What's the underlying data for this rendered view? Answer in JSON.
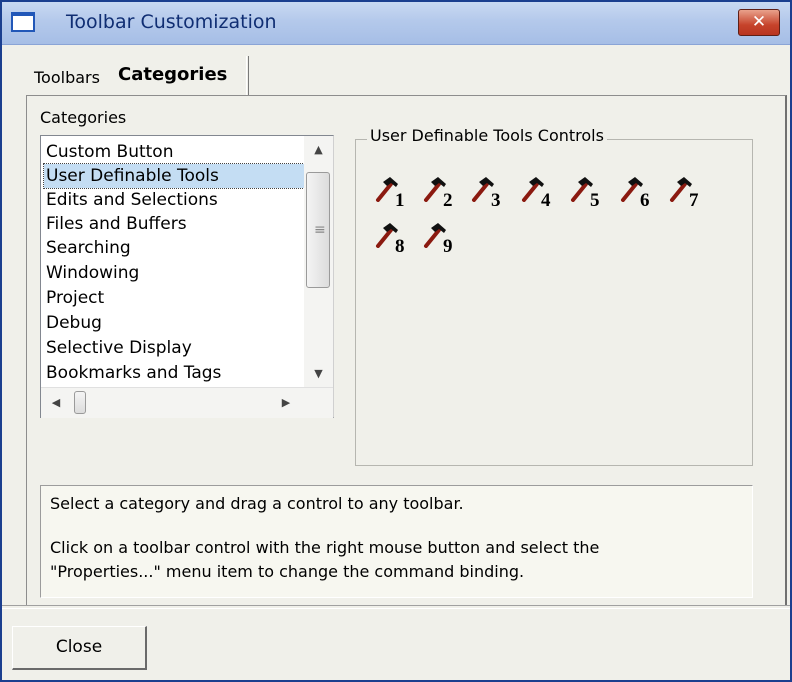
{
  "window": {
    "title": "Toolbar Customization",
    "close_glyph": "✕"
  },
  "tabs": [
    {
      "label": "Toolbars",
      "active": false
    },
    {
      "label": "Categories",
      "active": true
    }
  ],
  "categories": {
    "label": "Categories",
    "selected_index": 1,
    "items": [
      "Custom Button",
      "User Definable Tools",
      "Edits and Selections",
      "Files and Buffers",
      "Searching",
      "Windowing",
      "Project",
      "Debug",
      "Selective Display",
      "Bookmarks and Tags"
    ]
  },
  "controls": {
    "label": "User Definable Tools Controls",
    "icon": "hammer-icon",
    "items": [
      "1",
      "2",
      "3",
      "4",
      "5",
      "6",
      "7",
      "8",
      "9"
    ]
  },
  "description": {
    "line1": "Select a category and drag a control to any toolbar.",
    "line2": "Click on a toolbar control with the right mouse button and select the",
    "line3": "\"Properties...\" menu item to change the command binding."
  },
  "footer": {
    "close_label": "Close"
  },
  "colors": {
    "selection": "#c4ddf3",
    "hammer_head": "#111111",
    "hammer_handle": "#8b1a10"
  }
}
